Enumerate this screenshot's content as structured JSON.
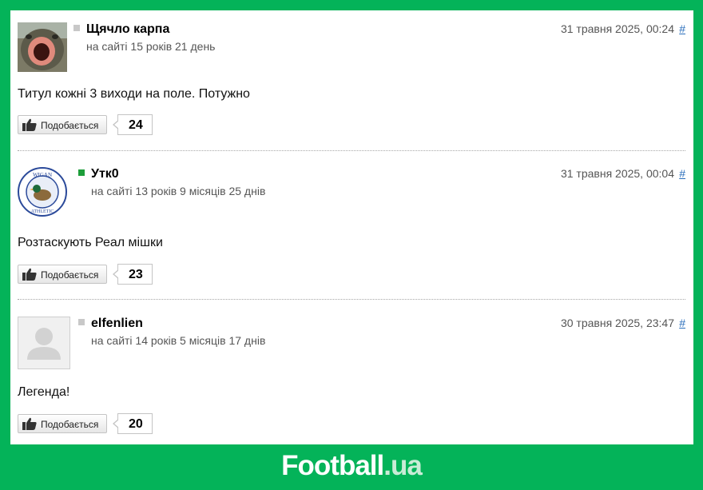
{
  "comments": [
    {
      "avatar": "carp-mouth-avatar",
      "status_color": "#c8c8c8",
      "username": "Щячло карпа",
      "since": "на сайті 15 років 21 день",
      "date": "31 травня 2025, 00:24",
      "permalink": "#",
      "text": "Титул кожні 3 виходи на поле. Потужно",
      "like_label": "Подобається",
      "likes": "24"
    },
    {
      "avatar": "wigan-athletic-crest-avatar",
      "status_color": "#1d9e3a",
      "username": "Утк0",
      "since": "на сайті 13 років 9 місяців 25 днів",
      "date": "31 травня 2025, 00:04",
      "permalink": "#",
      "text": "Розтаскують Реал мішки",
      "like_label": "Подобається",
      "likes": "23"
    },
    {
      "avatar": "default-user-avatar",
      "status_color": "#c8c8c8",
      "username": "elfenlien",
      "since": "на сайті 14 років 5 місяців 17 днів",
      "date": "30 травня 2025, 23:47",
      "permalink": "#",
      "text": "Легенда!",
      "like_label": "Подобається",
      "likes": "20"
    }
  ],
  "footer": {
    "brand_main": "Football",
    "brand_tld": ".ua"
  },
  "colors": {
    "background": "#04b359",
    "panel": "#ffffff",
    "link": "#2a6ebb"
  }
}
